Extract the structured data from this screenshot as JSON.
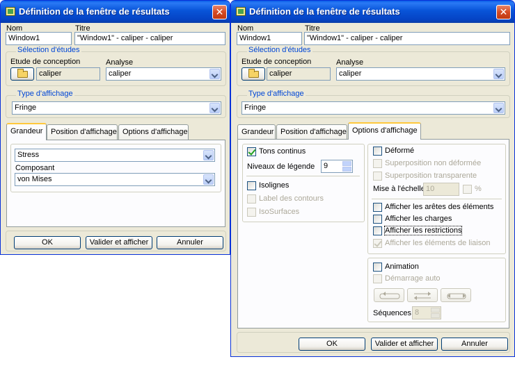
{
  "left_window": {
    "title": "Définition de la fenêtre de résultats",
    "name_label": "Nom",
    "name_value": "Window1",
    "title_label": "Titre",
    "title_value": "\"Window1\" - caliper - caliper",
    "studies_group": "Sélection d'études",
    "design_study_label": "Etude de conception",
    "design_study_value": "caliper",
    "analysis_label": "Analyse",
    "analysis_value": "caliper",
    "display_type_group": "Type d'affichage",
    "display_type_value": "Fringe",
    "tabs": [
      "Grandeur",
      "Position d'affichage",
      "Options d'affichage"
    ],
    "active_tab": "Grandeur",
    "quantity_value": "Stress",
    "component_label": "Composant",
    "component_value": "von Mises",
    "ok_label": "OK",
    "apply_label": "Valider et afficher",
    "cancel_label": "Annuler"
  },
  "right_window": {
    "title": "Définition de la fenêtre de résultats",
    "name_label": "Nom",
    "name_value": "Window1",
    "title_label": "Titre",
    "title_value": "\"Window1\" - caliper - caliper",
    "studies_group": "Sélection d'études",
    "design_study_label": "Etude de conception",
    "design_study_value": "caliper",
    "analysis_label": "Analyse",
    "analysis_value": "caliper",
    "display_type_group": "Type d'affichage",
    "display_type_value": "Fringe",
    "tabs": [
      "Grandeur",
      "Position d'affichage",
      "Options d'affichage"
    ],
    "active_tab": "Options d'affichage",
    "options": {
      "continuous_tones": "Tons continus",
      "legend_levels_label": "Niveaux de légende",
      "legend_levels_value": "9",
      "isolines": "Isolignes",
      "contour_label": "Label des contours",
      "isosurfaces": "IsoSurfaces",
      "deformed": "Déformé",
      "overlay_undeformed": "Superposition non déformée",
      "overlay_transparent": "Superposition transparente",
      "scaling_label": "Mise à l'échelle",
      "scaling_value": "10",
      "percent_label": "%",
      "show_edges": "Afficher les arêtes des éléments",
      "show_loads": "Afficher les charges",
      "show_restraints": "Afficher les restrictions",
      "show_link_elements": "Afficher les éléments de liaison",
      "animation": "Animation",
      "auto_start": "Démarrage auto",
      "sequences_label": "Séquences",
      "sequences_value": "8"
    },
    "ok_label": "OK",
    "apply_label": "Valider et afficher",
    "cancel_label": "Annuler"
  },
  "colors": {
    "title_bar": "#0854d8",
    "window_face": "#ece9d8",
    "group_title": "#0046d5",
    "close_button": "#d54a23",
    "check_mark": "#21a121"
  },
  "checkbox_states": {
    "continuous_tones": true,
    "isolines": false,
    "contour_label": false,
    "isosurfaces": false,
    "deformed": false,
    "overlay_undeformed": false,
    "overlay_transparent": false,
    "scaling_percent": false,
    "show_edges": false,
    "show_loads": false,
    "show_restraints": false,
    "show_link_elements": true,
    "animation": false,
    "auto_start": false
  }
}
